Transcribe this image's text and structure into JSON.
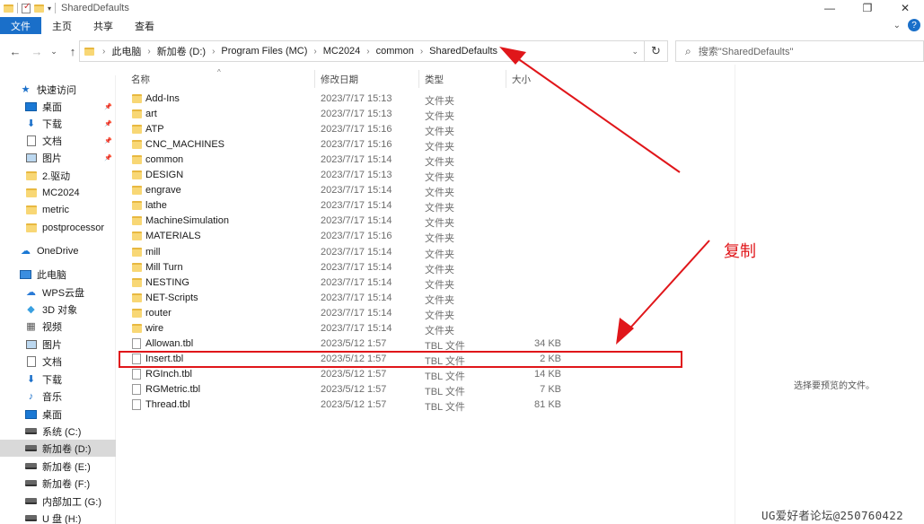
{
  "window": {
    "title": "SharedDefaults",
    "minimize": "—",
    "maximize": "❐",
    "close": "✕"
  },
  "ribbon": {
    "tabs": [
      "文件",
      "主页",
      "共享",
      "查看"
    ]
  },
  "nav": {
    "back": "←",
    "forward": "→",
    "recent": "⌄",
    "up": "↑",
    "refresh": "↻",
    "breadcrumb": [
      "此电脑",
      "新加卷 (D:)",
      "Program Files (MC)",
      "MC2024",
      "common",
      "SharedDefaults"
    ],
    "search_placeholder": "搜索\"SharedDefaults\""
  },
  "sidebar": {
    "items": [
      {
        "label": "快速访问",
        "icon": "star-icon",
        "glyph": "★",
        "color": "#1a6fc9"
      },
      {
        "label": "桌面",
        "icon": "desktop-icon",
        "pinned": true
      },
      {
        "label": "下载",
        "icon": "download-icon",
        "glyph": "⬇",
        "color": "#1a6fc9",
        "pinned": true
      },
      {
        "label": "文档",
        "icon": "document-icon",
        "pinned": true
      },
      {
        "label": "图片",
        "icon": "pictures-icon",
        "pinned": true
      },
      {
        "label": "2.驱动",
        "icon": "folder-icon"
      },
      {
        "label": "MC2024",
        "icon": "folder-icon"
      },
      {
        "label": "metric",
        "icon": "folder-icon"
      },
      {
        "label": "postprocessor",
        "icon": "folder-icon"
      },
      {
        "label": "OneDrive",
        "icon": "onedrive-icon",
        "glyph": "☁",
        "color": "#1a78d4"
      },
      {
        "label": "此电脑",
        "icon": "this-pc-icon"
      },
      {
        "label": "WPS云盘",
        "icon": "wps-cloud-icon",
        "glyph": "☁",
        "color": "#2a7ad6"
      },
      {
        "label": "3D 对象",
        "icon": "3d-objects-icon",
        "glyph": "◆",
        "color": "#3aa0e0"
      },
      {
        "label": "视频",
        "icon": "video-icon",
        "glyph": "▦",
        "color": "#555"
      },
      {
        "label": "图片",
        "icon": "pictures-icon"
      },
      {
        "label": "文档",
        "icon": "document-icon"
      },
      {
        "label": "下载",
        "icon": "download-icon",
        "glyph": "⬇",
        "color": "#1a6fc9"
      },
      {
        "label": "音乐",
        "icon": "music-icon",
        "glyph": "♪",
        "color": "#1a6fc9"
      },
      {
        "label": "桌面",
        "icon": "desktop-icon"
      },
      {
        "label": "系统 (C:)",
        "icon": "drive-c-icon"
      },
      {
        "label": "新加卷 (D:)",
        "icon": "drive-icon",
        "selected": true
      },
      {
        "label": "新加卷 (E:)",
        "icon": "drive-icon"
      },
      {
        "label": "新加卷 (F:)",
        "icon": "drive-icon"
      },
      {
        "label": "内部加工 (G:)",
        "icon": "drive-icon"
      },
      {
        "label": "U 盘 (H:)",
        "icon": "usb-drive-icon"
      }
    ]
  },
  "columns": {
    "name": "名称",
    "date": "修改日期",
    "type": "类型",
    "size": "大小"
  },
  "files": [
    {
      "name": "Add-Ins",
      "date": "2023/7/17 15:13",
      "type": "文件夹",
      "size": "",
      "kind": "folder"
    },
    {
      "name": "art",
      "date": "2023/7/17 15:13",
      "type": "文件夹",
      "size": "",
      "kind": "folder"
    },
    {
      "name": "ATP",
      "date": "2023/7/17 15:16",
      "type": "文件夹",
      "size": "",
      "kind": "folder"
    },
    {
      "name": "CNC_MACHINES",
      "date": "2023/7/17 15:16",
      "type": "文件夹",
      "size": "",
      "kind": "folder"
    },
    {
      "name": "common",
      "date": "2023/7/17 15:14",
      "type": "文件夹",
      "size": "",
      "kind": "folder"
    },
    {
      "name": "DESIGN",
      "date": "2023/7/17 15:13",
      "type": "文件夹",
      "size": "",
      "kind": "folder"
    },
    {
      "name": "engrave",
      "date": "2023/7/17 15:14",
      "type": "文件夹",
      "size": "",
      "kind": "folder"
    },
    {
      "name": "lathe",
      "date": "2023/7/17 15:14",
      "type": "文件夹",
      "size": "",
      "kind": "folder"
    },
    {
      "name": "MachineSimulation",
      "date": "2023/7/17 15:14",
      "type": "文件夹",
      "size": "",
      "kind": "folder"
    },
    {
      "name": "MATERIALS",
      "date": "2023/7/17 15:16",
      "type": "文件夹",
      "size": "",
      "kind": "folder"
    },
    {
      "name": "mill",
      "date": "2023/7/17 15:14",
      "type": "文件夹",
      "size": "",
      "kind": "folder"
    },
    {
      "name": "Mill Turn",
      "date": "2023/7/17 15:14",
      "type": "文件夹",
      "size": "",
      "kind": "folder"
    },
    {
      "name": "NESTING",
      "date": "2023/7/17 15:14",
      "type": "文件夹",
      "size": "",
      "kind": "folder"
    },
    {
      "name": "NET-Scripts",
      "date": "2023/7/17 15:14",
      "type": "文件夹",
      "size": "",
      "kind": "folder"
    },
    {
      "name": "router",
      "date": "2023/7/17 15:14",
      "type": "文件夹",
      "size": "",
      "kind": "folder"
    },
    {
      "name": "wire",
      "date": "2023/7/17 15:14",
      "type": "文件夹",
      "size": "",
      "kind": "folder"
    },
    {
      "name": "Allowan.tbl",
      "date": "2023/5/12 1:57",
      "type": "TBL 文件",
      "size": "34 KB",
      "kind": "file"
    },
    {
      "name": "Insert.tbl",
      "date": "2023/5/12 1:57",
      "type": "TBL 文件",
      "size": "2 KB",
      "kind": "file",
      "highlighted": true
    },
    {
      "name": "RGInch.tbl",
      "date": "2023/5/12 1:57",
      "type": "TBL 文件",
      "size": "14 KB",
      "kind": "file"
    },
    {
      "name": "RGMetric.tbl",
      "date": "2023/5/12 1:57",
      "type": "TBL 文件",
      "size": "7 KB",
      "kind": "file"
    },
    {
      "name": "Thread.tbl",
      "date": "2023/5/12 1:57",
      "type": "TBL 文件",
      "size": "81 KB",
      "kind": "file"
    }
  ],
  "preview": {
    "message": "选择要预览的文件。"
  },
  "annotation": {
    "text": "复制",
    "color": "#e0161a"
  },
  "watermark": "UG爱好者论坛@250760422"
}
